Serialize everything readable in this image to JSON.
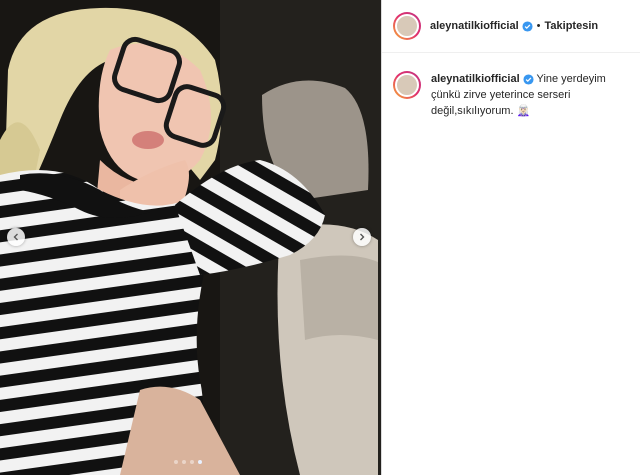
{
  "post": {
    "username": "aleynatilkiofficial",
    "verified": true,
    "separator": "•",
    "follow_label": "Takiptesin",
    "caption": "Yine yerdeyim çünkü zirve yeterince serseri değil,sıkılıyorum. 🧝🏻‍♀️",
    "carousel": {
      "slide_count": 4,
      "active_index": 3
    }
  },
  "colors": {
    "verified_badge": "#3897f0",
    "text": "#262626",
    "border": "#dbdbdb"
  },
  "icons": {
    "prev": "chevron-left-icon",
    "next": "chevron-right-icon",
    "verified": "verified-badge-icon"
  }
}
